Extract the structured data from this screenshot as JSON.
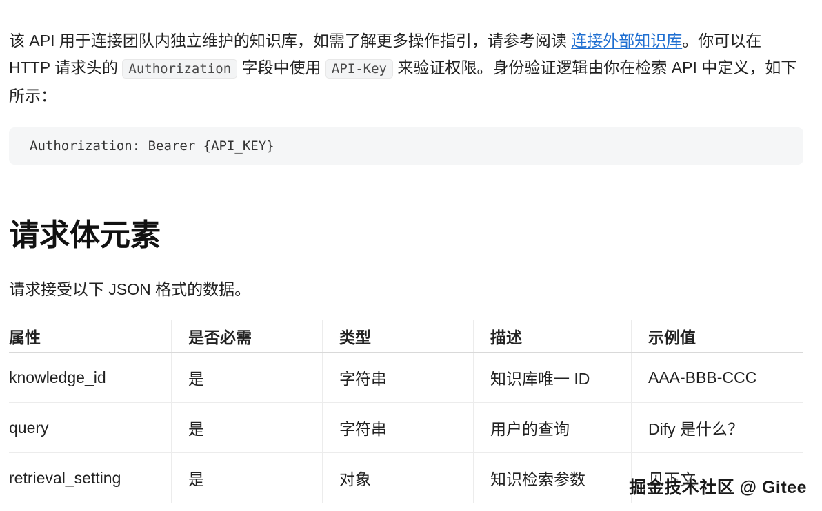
{
  "intro": {
    "before_link": "该 API 用于连接团队内独立维护的知识库，如需了解更多操作指引，请参考阅读 ",
    "link_text": "连接外部知识库",
    "after_link": "。你可以在 HTTP 请求头的 ",
    "code1": "Authorization",
    "middle": " 字段中使用 ",
    "code2": "API-Key",
    "end": " 来验证权限。身份验证逻辑由你在检索 API 中定义，如下所示："
  },
  "code_block": "Authorization: Bearer {API_KEY}",
  "section": {
    "heading": "请求体元素",
    "description": "请求接受以下 JSON 格式的数据。"
  },
  "table": {
    "headers": [
      "属性",
      "是否必需",
      "类型",
      "描述",
      "示例值"
    ],
    "rows": [
      [
        "knowledge_id",
        "是",
        "字符串",
        "知识库唯一 ID",
        "AAA-BBB-CCC"
      ],
      [
        "query",
        "是",
        "字符串",
        "用户的查询",
        "Dify 是什么？"
      ],
      [
        "retrieval_setting",
        "是",
        "对象",
        "知识检索参数",
        "见下文"
      ]
    ]
  },
  "watermark": "掘金技术社区 @ Gitee"
}
